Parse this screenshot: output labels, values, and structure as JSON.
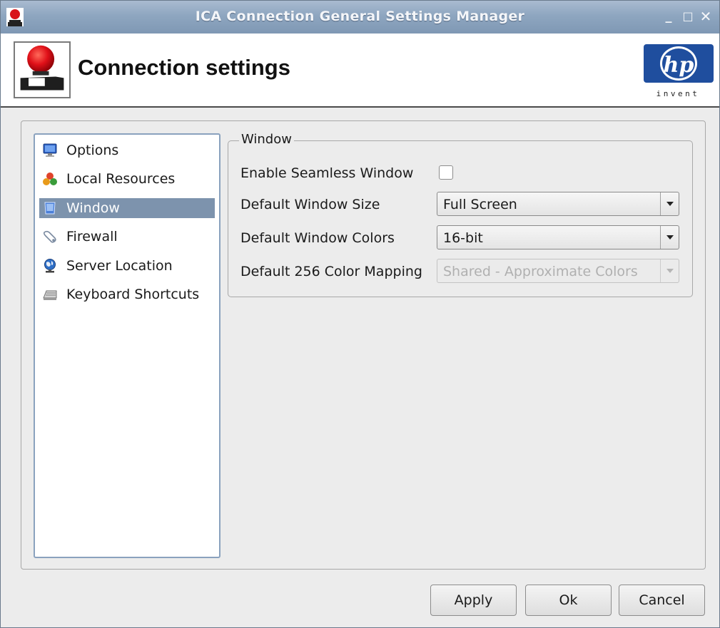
{
  "window": {
    "title": "ICA Connection General Settings Manager",
    "controls": {
      "minimize": "_",
      "maximize": "□",
      "close": "✕"
    }
  },
  "header": {
    "title": "Connection settings",
    "logo_text": "invent"
  },
  "nav": {
    "items": [
      {
        "label": "Options",
        "icon": "monitor-icon",
        "selected": false
      },
      {
        "label": "Local Resources",
        "icon": "resources-icon",
        "selected": false
      },
      {
        "label": "Window",
        "icon": "window-icon",
        "selected": true
      },
      {
        "label": "Firewall",
        "icon": "firewall-icon",
        "selected": false
      },
      {
        "label": "Server Location",
        "icon": "globe-icon",
        "selected": false
      },
      {
        "label": "Keyboard Shortcuts",
        "icon": "keyboard-icon",
        "selected": false
      }
    ]
  },
  "window_group": {
    "legend": "Window",
    "seamless_label": "Enable Seamless Window",
    "seamless_checked": false,
    "size_label": "Default Window Size",
    "size_value": "Full Screen",
    "colors_label": "Default Window Colors",
    "colors_value": "16-bit",
    "mapping_label": "Default 256 Color Mapping",
    "mapping_value": "Shared - Approximate Colors",
    "mapping_enabled": false
  },
  "buttons": {
    "apply": "Apply",
    "ok": "Ok",
    "cancel": "Cancel"
  },
  "colors": {
    "selection": "#7d93ad",
    "titlebar": "#8ea6c0",
    "nav_border": "#8aa2be",
    "hp_blue": "#1f4e9e"
  }
}
